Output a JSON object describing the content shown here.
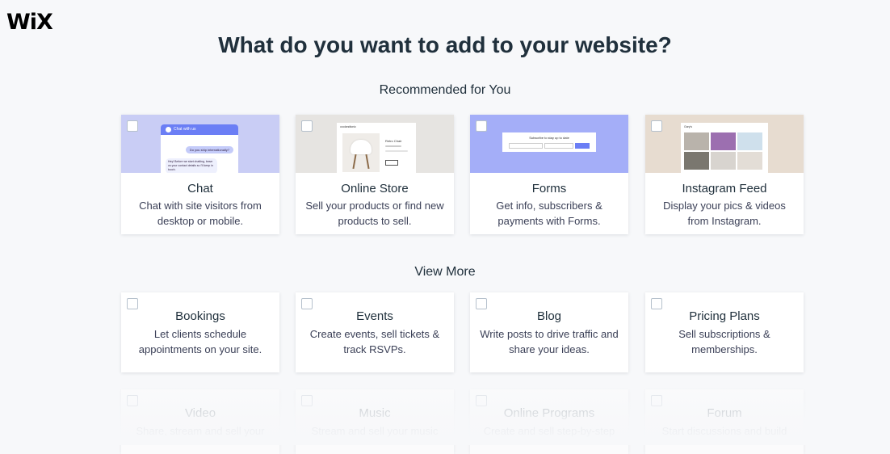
{
  "logo": "WiX",
  "heading": "What do you want to add to your website?",
  "sections": {
    "recommended": "Recommended for You",
    "view_more": "View More"
  },
  "recommended": [
    {
      "name": "Chat",
      "desc": "Chat with site visitors from desktop or mobile.",
      "thumb_color": "#c9cdf5"
    },
    {
      "name": "Online Store",
      "desc": "Sell your products or find new products to sell.",
      "thumb_color": "#e6e4e1"
    },
    {
      "name": "Forms",
      "desc": "Get info, subscribers & payments with Forms.",
      "thumb_color": "#a4aef8"
    },
    {
      "name": "Instagram Feed",
      "desc": "Display your pics & videos from Instagram.",
      "thumb_color": "#e7dcd0"
    }
  ],
  "view_more": [
    {
      "name": "Bookings",
      "desc": "Let clients schedule appointments on your site."
    },
    {
      "name": "Events",
      "desc": "Create events, sell tickets & track RSVPs."
    },
    {
      "name": "Blog",
      "desc": "Write posts to drive traffic and share your ideas."
    },
    {
      "name": "Pricing Plans",
      "desc": "Sell subscriptions & memberships."
    }
  ],
  "more": [
    {
      "name": "Video",
      "desc": "Share, stream and sell your"
    },
    {
      "name": "Music",
      "desc": "Stream and sell your music"
    },
    {
      "name": "Online Programs",
      "desc": "Create and sell step-by-step"
    },
    {
      "name": "Forum",
      "desc": "Start discussions and build"
    }
  ],
  "thumb_text": {
    "chat_header": "Chat with us",
    "chat_bubble": "Do you ship internationally?",
    "chat_reply": "Hey! Before we start chatting, leave us your contact details so I'll keep in touch.",
    "store_brand": "ooolandtonic",
    "store_product": "Retro Chair",
    "forms_headline": "Subscribe to stay up to date",
    "insta_label": "Gary's"
  },
  "colors": {
    "accent": "#116dff",
    "checkbox_border": "#b6c1cd",
    "title": "#20303c"
  }
}
